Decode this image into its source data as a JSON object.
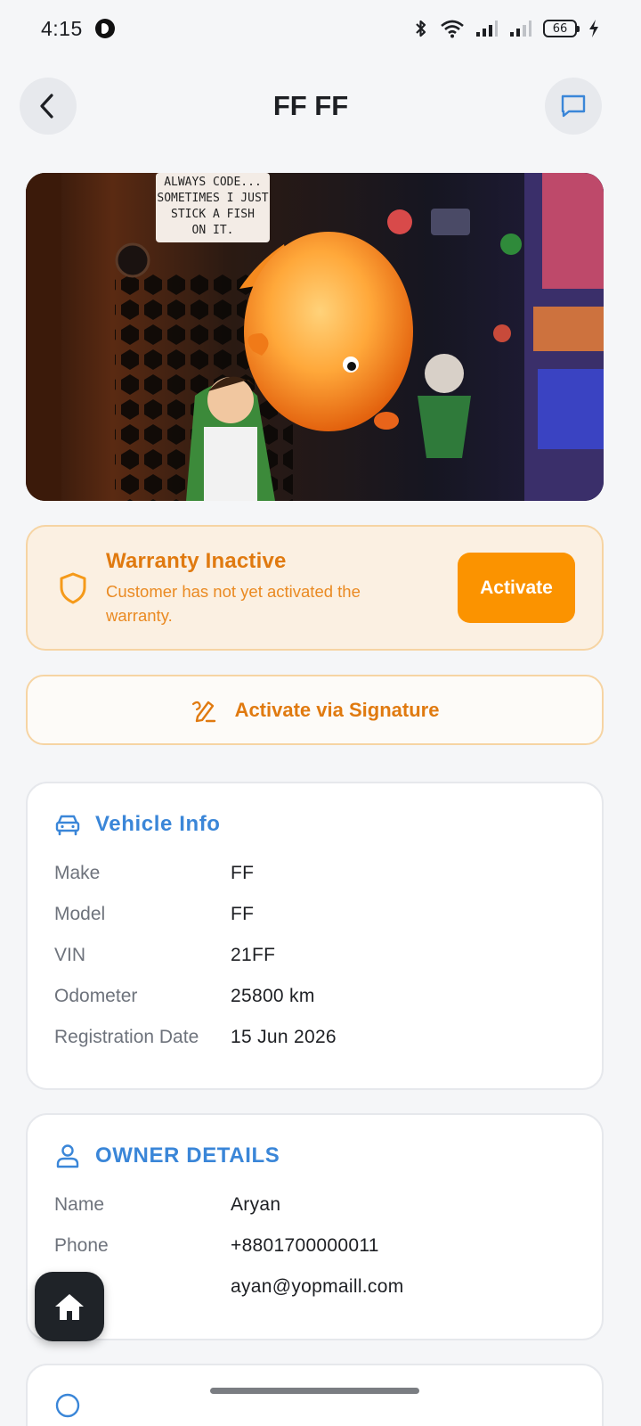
{
  "status_bar": {
    "time": "4:15",
    "battery": "66"
  },
  "header": {
    "title": "FF FF",
    "back_icon": "chevron-left-icon",
    "chat_icon": "chat-bubble-icon"
  },
  "hero": {
    "sign_text": [
      "ALWAYS CODE...",
      "SOMETIMES I JUST",
      "STICK A FISH",
      "ON IT."
    ]
  },
  "warranty": {
    "title": "Warranty Inactive",
    "description": "Customer has not yet activated the warranty.",
    "activate_label": "Activate",
    "icon": "shield-icon",
    "accent": "#fb9300"
  },
  "signature": {
    "label": "Activate via Signature",
    "icon": "signature-pen-icon"
  },
  "vehicle": {
    "title": "Vehicle Info",
    "icon": "car-icon",
    "rows": [
      {
        "label": "Make",
        "value": "FF"
      },
      {
        "label": "Model",
        "value": "FF"
      },
      {
        "label": "VIN",
        "value": "21FF"
      },
      {
        "label": "Odometer",
        "value": "25800 km"
      },
      {
        "label": "Registration Date",
        "value": "15 Jun 2026"
      }
    ]
  },
  "owner": {
    "title": "OWNER DETAILS",
    "icon": "person-icon",
    "rows": [
      {
        "label": "Name",
        "value": "Aryan"
      },
      {
        "label": "Phone",
        "value": "+8801700000011"
      },
      {
        "label": "",
        "value": "ayan@yopmaill.com"
      }
    ]
  },
  "colors": {
    "accent_blue": "#3a86d8",
    "accent_orange": "#e07a10"
  }
}
